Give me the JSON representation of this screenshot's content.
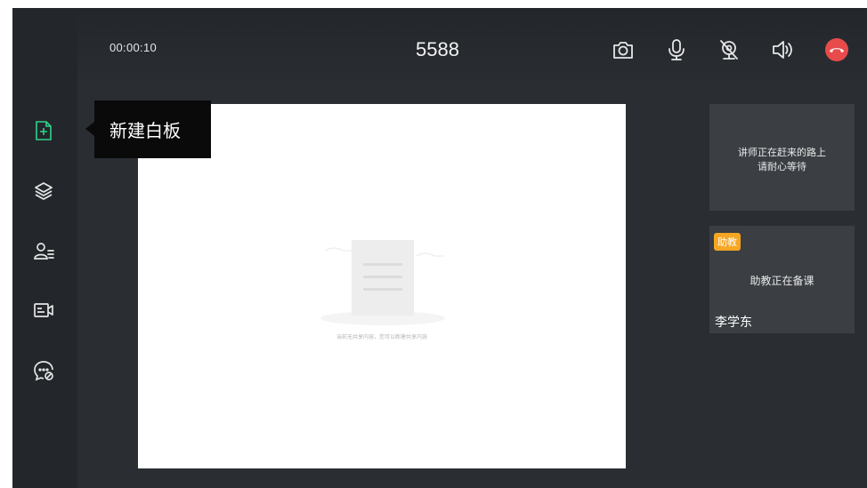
{
  "topbar": {
    "timer": "00:00:10",
    "room_title": "5588",
    "icons": [
      "camera-icon",
      "microphone-icon",
      "camera-off-icon",
      "speaker-icon",
      "hang-up-icon"
    ],
    "hangup_color": "#e84b4b"
  },
  "sidebar": {
    "items": [
      {
        "name": "new-whiteboard",
        "icon": "add-file-icon",
        "active": true
      },
      {
        "name": "layers",
        "icon": "layers-icon"
      },
      {
        "name": "user-list",
        "icon": "users-list-icon"
      },
      {
        "name": "video",
        "icon": "video-icon"
      },
      {
        "name": "chat",
        "icon": "chat-mute-icon"
      }
    ],
    "accent_color": "#2ed48a"
  },
  "tooltip": {
    "text": "新建白板"
  },
  "whiteboard": {
    "empty_text": "当前无共享内容，您可以新建共享内容"
  },
  "teacher_panel": {
    "line1": "讲师正在赶来的路上",
    "line2": "请耐心等待"
  },
  "assistant_panel": {
    "badge": "助教",
    "status": "助教正在备课",
    "name": "李学东",
    "badge_color": "#f5a623"
  }
}
